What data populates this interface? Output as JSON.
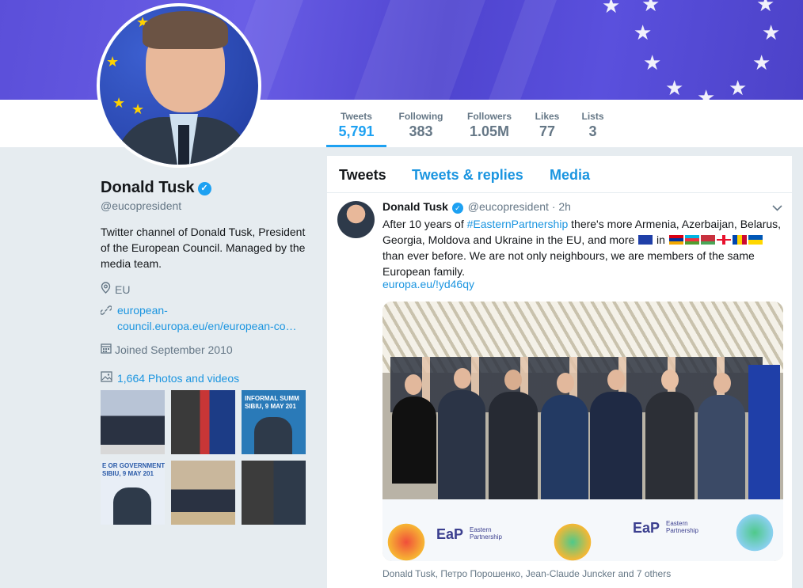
{
  "profile": {
    "name": "Donald Tusk",
    "handle": "@eucopresident",
    "bio": "Twitter channel of Donald Tusk, President of the European Council. Managed by the media team.",
    "location": "EU",
    "website_line1": "european-",
    "website_line2": "council.europa.eu/en/european-co…",
    "joined": "Joined September 2010",
    "photos_label": "1,664 Photos and videos"
  },
  "stats": [
    {
      "label": "Tweets",
      "value": "5,791"
    },
    {
      "label": "Following",
      "value": "383"
    },
    {
      "label": "Followers",
      "value": "1.05M"
    },
    {
      "label": "Likes",
      "value": "77"
    },
    {
      "label": "Lists",
      "value": "3"
    }
  ],
  "tabs": [
    "Tweets",
    "Tweets & replies",
    "Media"
  ],
  "tweet": {
    "name": "Donald Tusk",
    "handle": "@eucopresident",
    "time": "· 2h",
    "text_1": "After 10 years of ",
    "hashtag": "#EasternPartnership",
    "text_2": " there's more Armenia, Azerbaijan, Belarus, Georgia, Moldova and Ukraine in the EU, and more ",
    "text_3": " in ",
    "text_4": " than ever before. We are not only neighbours, we are members of the same European family.",
    "link": "europa.eu/!yd46qy",
    "caption": "Donald Tusk, Петро Порошенко, Jean-Claude Juncker and 7 others",
    "banner_brand": "EaP",
    "banner_sub": "Eastern Partnership"
  },
  "thumbnails": [
    {
      "text": ""
    },
    {
      "text": ""
    },
    {
      "text": "INFORMAL SUMM\nSIBIU, 9 MAY 201"
    },
    {
      "text": "E OR GOVERNMENT\nSIBIU, 9 MAY 201"
    },
    {
      "text": ""
    },
    {
      "text": ""
    }
  ],
  "colors": {
    "accent": "#1da1f2",
    "link": "#1b95e0",
    "banner": "#5b4fd9"
  }
}
